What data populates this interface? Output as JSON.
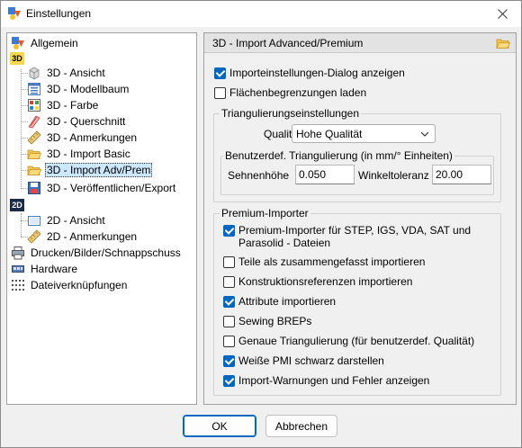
{
  "window": {
    "title": "Einstellungen"
  },
  "tree": {
    "items": [
      {
        "label": "Allgemein",
        "icon": "settings-shapes-icon"
      },
      {
        "label": "3D",
        "icon": "3d-badge-icon"
      },
      {
        "label": "3D - Ansicht",
        "icon": "cube-icon"
      },
      {
        "label": "3D - Modellbaum",
        "icon": "model-tree-icon"
      },
      {
        "label": "3D - Farbe",
        "icon": "color-palette-icon"
      },
      {
        "label": "3D - Querschnitt",
        "icon": "cross-section-icon"
      },
      {
        "label": "3D - Anmerkungen",
        "icon": "ruler-icon"
      },
      {
        "label": "3D - Import Basic",
        "icon": "open-folder-icon"
      },
      {
        "label": "3D - Import Adv/Prem",
        "icon": "open-folder-icon"
      },
      {
        "label": "3D - Veröffentlichen/Export",
        "icon": "save-disk-icon"
      },
      {
        "label": "2D",
        "icon": "2d-badge-icon"
      },
      {
        "label": "2D - Ansicht",
        "icon": "sheet-view-icon"
      },
      {
        "label": "2D - Anmerkungen",
        "icon": "ruler-icon"
      },
      {
        "label": "Drucken/Bilder/Schnappschuss",
        "icon": "printer-icon"
      },
      {
        "label": "Hardware",
        "icon": "hardware-icon"
      },
      {
        "label": "Dateiverknüpfungen",
        "icon": "file-association-icon"
      }
    ],
    "selected": "3D - Import Adv/Prem"
  },
  "panel": {
    "title": "3D - Import Advanced/Premium",
    "show_dialog": {
      "label": "Importeinstellungen-Dialog anzeigen",
      "checked": true
    },
    "load_face_bounds": {
      "label": "Flächenbegrenzungen laden",
      "checked": false
    },
    "triangulation": {
      "group_label": "Triangulierungseinstellungen",
      "quality_label": "Qualität",
      "quality_value": "Hohe Qualität",
      "custom_group_label": "Benutzerdef. Triangulierung (in mm/° Einheiten)",
      "chord_label": "Sehnenhöhe",
      "chord_value": "0.050",
      "angle_label": "Winkeltoleranz",
      "angle_value": "20.00"
    },
    "premium": {
      "group_label": "Premium-Importer",
      "options": [
        {
          "label": "Premium-Importer für STEP, IGS, VDA, SAT und\nParasolid - Dateien",
          "line1": "Premium-Importer für STEP, IGS, VDA, SAT und",
          "line2": "Parasolid - Dateien",
          "checked": true
        },
        {
          "label": "Teile als zusammengefasst importieren",
          "checked": false
        },
        {
          "label": "Konstruktionsreferenzen importieren",
          "checked": false
        },
        {
          "label": "Attribute importieren",
          "checked": true
        },
        {
          "label": "Sewing BREPs",
          "checked": false
        },
        {
          "label": "Genaue Triangulierung (für benutzerdef. Qualität)",
          "checked": false
        },
        {
          "label": "Weiße PMI schwarz darstellen",
          "checked": true
        },
        {
          "label": "Import-Warnungen und Fehler anzeigen",
          "checked": true
        }
      ]
    }
  },
  "footer": {
    "ok_label": "OK",
    "cancel_label": "Abbrechen"
  },
  "colors": {
    "accent": "#0067c0",
    "selection": "#cce8ff"
  }
}
